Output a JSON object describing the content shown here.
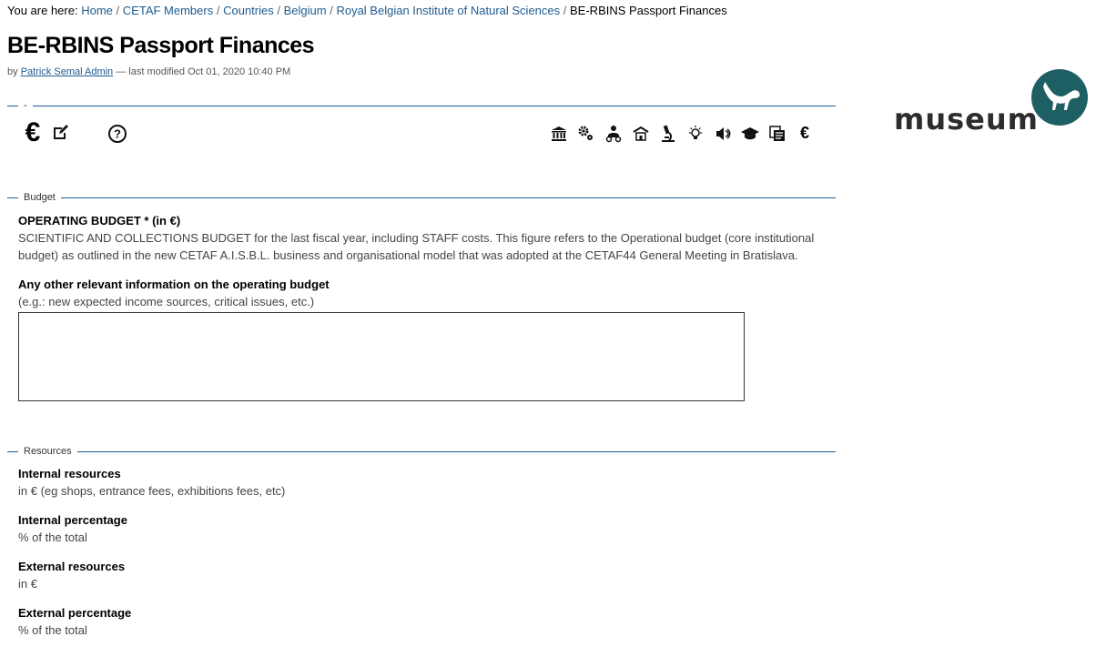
{
  "breadcrumb": {
    "prefix": "You are here:",
    "items": [
      "Home",
      "CETAF Members",
      "Countries",
      "Belgium",
      "Royal Belgian Institute of Natural Sciences"
    ],
    "current": "BE-RBINS Passport Finances",
    "separator": "/"
  },
  "page": {
    "title": "BE-RBINS Passport Finances",
    "by": "by",
    "author": "Patrick Semal Admin",
    "modified": "— last modified Oct 01, 2020 10:40 PM"
  },
  "top_section": {
    "legend": "-",
    "left_icons": [
      "euro-icon",
      "edit-icon",
      "help-icon"
    ],
    "right_icons": [
      "institution-icon",
      "gears-icon",
      "people-icon",
      "building-icon",
      "microscope-icon",
      "bulb-icon",
      "megaphone-icon",
      "graduation-cap-icon",
      "documents-icon",
      "euro-icon"
    ]
  },
  "budget": {
    "legend": "Budget",
    "operating_label": "OPERATING BUDGET * (in €)",
    "operating_help_1": "SCIENTIFIC AND COLLECTIONS BUDGET for the last fiscal year, including STAFF costs. This figure refers to the Operational budget (core institutional",
    "operating_help_2": "budget) as outlined in the new CETAF A.I.S.B.L. business and organisational model that was adopted at the CETAF44 General Meeting in Bratislava.",
    "other_label": "Any other relevant information on the operating budget",
    "other_help": "(e.g.: new expected income sources, critical issues, etc.)",
    "other_value": ""
  },
  "resources": {
    "legend": "Resources",
    "internal_label": "Internal resources",
    "internal_help": "in € (eg shops, entrance fees, exhibitions fees, etc)",
    "internal_pct_label": "Internal percentage",
    "internal_pct_help": "% of the total",
    "external_label": "External resources",
    "external_help": "in €",
    "external_pct_label": "External percentage",
    "external_pct_help": "% of the total"
  },
  "logo": {
    "text": "museum",
    "color": "#1e5f63"
  }
}
